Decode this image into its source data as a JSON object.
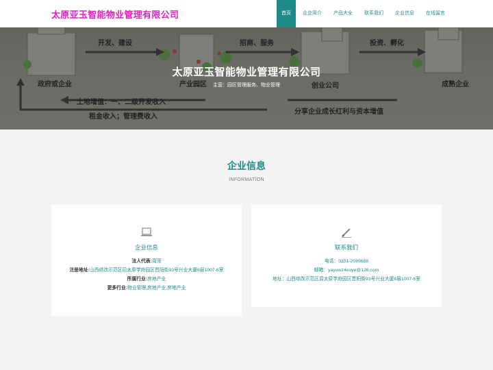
{
  "header": {
    "logo": "太原亚玉智能物业管理有限公司",
    "nav": [
      {
        "label": "首页",
        "active": true
      },
      {
        "label": "企业简介",
        "active": false
      },
      {
        "label": "产品大全",
        "active": false
      },
      {
        "label": "联系我们",
        "active": false
      },
      {
        "label": "企业信息",
        "active": false
      },
      {
        "label": "在线留言",
        "active": false
      }
    ]
  },
  "hero": {
    "title": "太原亚玉智能物业管理有限公司",
    "subtitle": "主营：园区管理服务、物业管理",
    "diagram_labels": [
      "开发、建设",
      "招商、服务",
      "投资、孵化",
      "政府或企业",
      "产业园区",
      "创业公司",
      "成熟企业",
      "土地增值：一、二级开发收入",
      "租金收入；管理费收入",
      "分享企业成长红利与资本增值"
    ]
  },
  "section": {
    "title": "企业信息",
    "subtitle": "INFORMATION"
  },
  "company_card": {
    "icon": "laptop-icon",
    "title": "企业信息",
    "rows": [
      {
        "label": "法人代表:",
        "value": "周滢"
      },
      {
        "label": "注册地址:",
        "value": "山西综改示范区后太原学府园区晋阳街93号兴业大厦6层1007-6室"
      },
      {
        "label": "所属行业:",
        "value": "房地产业"
      },
      {
        "label": "更多行业:",
        "value": "物业管理,房地产业,房地产业"
      }
    ]
  },
  "contact_card": {
    "icon": "pencil-icon",
    "title": "联系我们",
    "rows": [
      {
        "label": "电话：",
        "value": "0351-2089688"
      },
      {
        "label": "邮箱：",
        "value": "yayuwz4euye@126.com"
      },
      {
        "label": "地址：",
        "value": "山西综改示范区后太原学府园区晋阳街93号兴业大厦6层1007-6室"
      }
    ]
  },
  "colors": {
    "accent": "#1e8a87",
    "logo": "#e020c0",
    "background": "#f4f4f4"
  }
}
